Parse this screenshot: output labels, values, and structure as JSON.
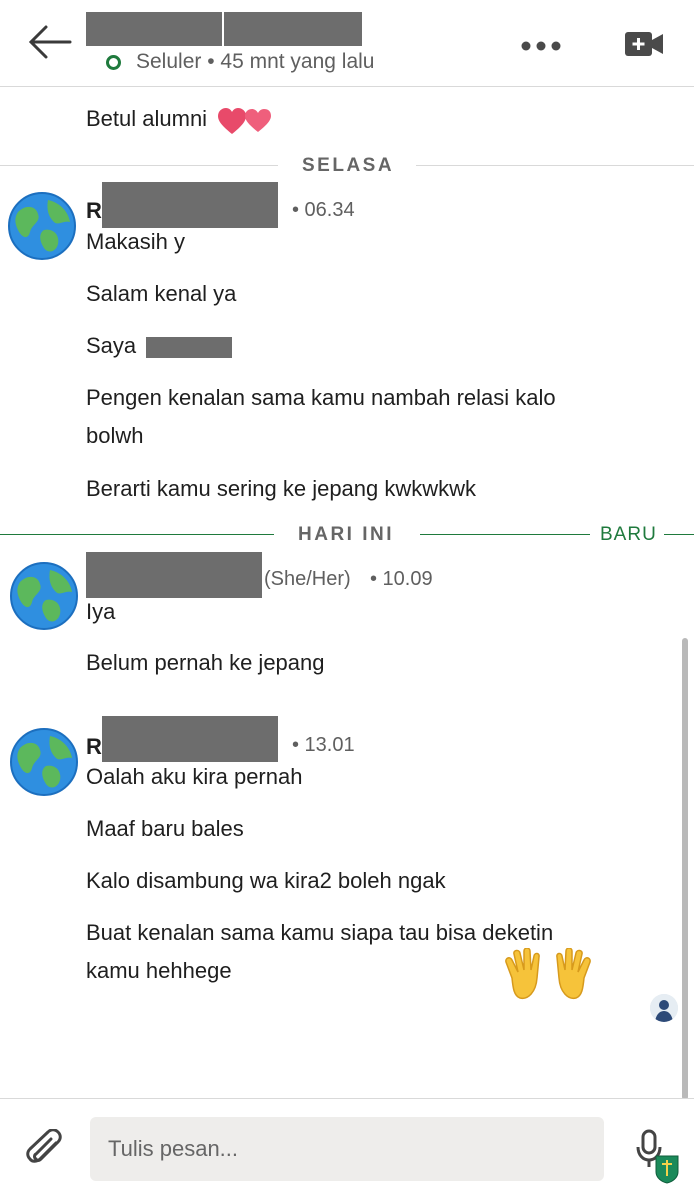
{
  "header": {
    "status_text": "Seluler • 45 mnt yang lalu"
  },
  "messages_top": {
    "text": "Betul alumni"
  },
  "dividers": {
    "tuesday": "SELASA",
    "today": "HARI INI",
    "new_label": "BARU"
  },
  "groups": [
    {
      "initial": "R",
      "time": "• 06.34",
      "lines": [
        "Makasih y",
        "Salam kenal ya",
        "Saya",
        "Pengen kenalan sama kamu nambah relasi kalo",
        "bolwh",
        "Berarti kamu sering ke jepang kwkwkwk"
      ]
    },
    {
      "pronoun": "(She/Her)",
      "time": "• 10.09",
      "lines": [
        "Iya",
        "Belum pernah ke jepang"
      ]
    },
    {
      "initial": "R",
      "time": "• 13.01",
      "lines": [
        "Oalah aku kira pernah",
        "Maaf baru bales",
        "Kalo disambung wa kira2 boleh ngak",
        "Buat kenalan sama kamu siapa tau bisa deketin",
        "kamu hehhege"
      ]
    }
  ],
  "composer": {
    "placeholder": "Tulis pesan..."
  },
  "colors": {
    "accent_green": "#1f7a3d",
    "redaction": "#6d6d6d"
  },
  "icons": [
    "back-arrow-icon",
    "online-status-icon",
    "more-options-icon",
    "video-call-icon",
    "heart-icon",
    "globe-avatar-icon",
    "raised-hands-icon",
    "attach-paperclip-icon",
    "microphone-icon"
  ]
}
